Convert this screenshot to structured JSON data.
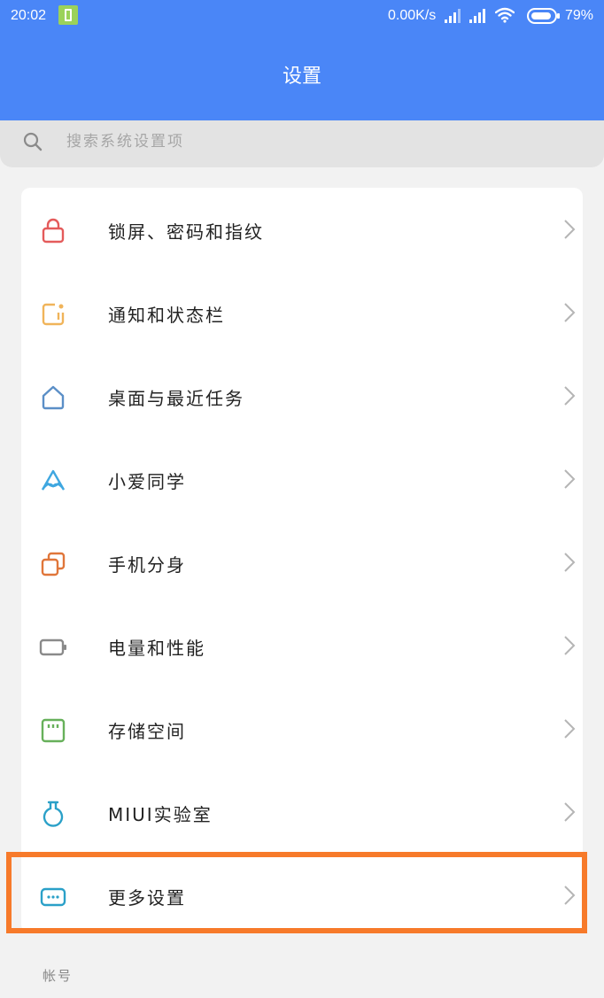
{
  "status": {
    "time": "20:02",
    "speed": "0.00K/s",
    "battery_pct": "79%"
  },
  "app_bar": {
    "title": "设置"
  },
  "search": {
    "placeholder": "搜索系统设置项"
  },
  "colors": {
    "primary": "#4a86f7",
    "highlight": "#f77a2a"
  },
  "settings_items": [
    {
      "label": "锁屏、密码和指纹",
      "icon": "lock-icon",
      "color": "#e45b5b"
    },
    {
      "label": "通知和状态栏",
      "icon": "notification-icon",
      "color": "#f0b45a"
    },
    {
      "label": "桌面与最近任务",
      "icon": "home-icon",
      "color": "#5b8fc7"
    },
    {
      "label": "小爱同学",
      "icon": "xiaoai-icon",
      "color": "#3fa7e0"
    },
    {
      "label": "手机分身",
      "icon": "dual-phone-icon",
      "color": "#e0763a"
    },
    {
      "label": "电量和性能",
      "icon": "battery-icon",
      "color": "#8a8a8a"
    },
    {
      "label": "存储空间",
      "icon": "storage-icon",
      "color": "#67b05a"
    },
    {
      "label": "MIUI实验室",
      "icon": "lab-flask-icon",
      "color": "#2aa0c8"
    },
    {
      "label": "更多设置",
      "icon": "more-settings-icon",
      "color": "#2aa0c8"
    }
  ],
  "section": {
    "account_header": "帐号"
  }
}
